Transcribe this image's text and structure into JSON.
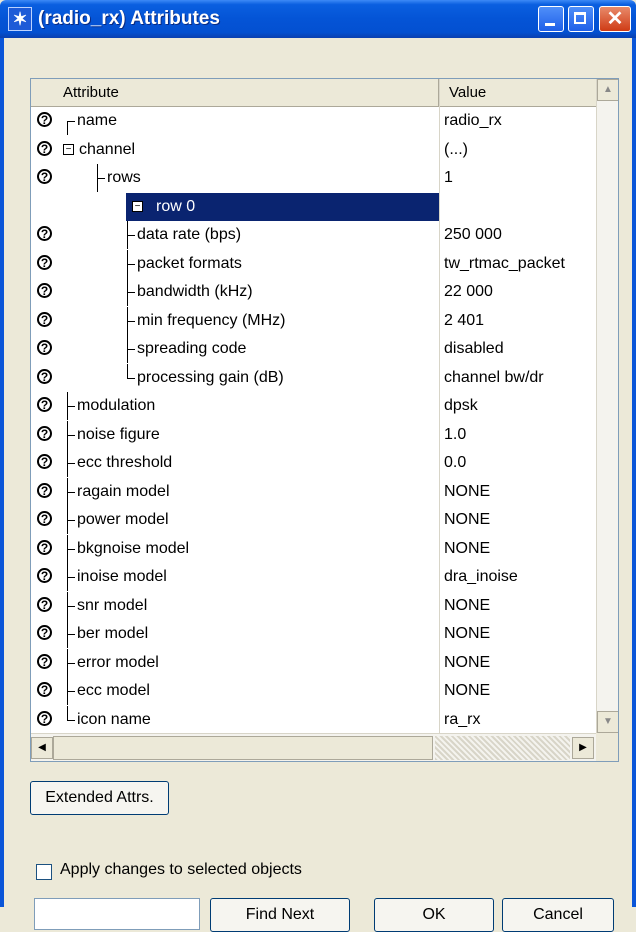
{
  "window": {
    "title": "(radio_rx) Attributes"
  },
  "grid": {
    "header_attribute": "Attribute",
    "header_value": "Value",
    "rows": [
      {
        "label": "name",
        "value": "radio_rx",
        "depth": 0,
        "help": true
      },
      {
        "label": "channel",
        "value": "(...)",
        "depth": 0,
        "help": true,
        "expander": "minus"
      },
      {
        "label": "rows",
        "value": "1",
        "depth": 1,
        "help": true
      },
      {
        "label": "row 0",
        "value": "",
        "depth": 1,
        "help": false,
        "expander": "minus",
        "selected": true
      },
      {
        "label": "data rate (bps)",
        "value": "250 000",
        "depth": 2,
        "help": true
      },
      {
        "label": "packet formats",
        "value": "tw_rtmac_packet",
        "depth": 2,
        "help": true
      },
      {
        "label": "bandwidth (kHz)",
        "value": "22 000",
        "depth": 2,
        "help": true
      },
      {
        "label": "min frequency (MHz)",
        "value": "2 401",
        "depth": 2,
        "help": true
      },
      {
        "label": "spreading code",
        "value": "disabled",
        "depth": 2,
        "help": true
      },
      {
        "label": "processing gain (dB)",
        "value": "channel bw/dr",
        "depth": 2,
        "help": true
      },
      {
        "label": "modulation",
        "value": "dpsk",
        "depth": 0,
        "help": true
      },
      {
        "label": "noise figure",
        "value": "1.0",
        "depth": 0,
        "help": true
      },
      {
        "label": "ecc threshold",
        "value": "0.0",
        "depth": 0,
        "help": true
      },
      {
        "label": "ragain model",
        "value": "NONE",
        "depth": 0,
        "help": true
      },
      {
        "label": "power model",
        "value": "NONE",
        "depth": 0,
        "help": true
      },
      {
        "label": "bkgnoise model",
        "value": "NONE",
        "depth": 0,
        "help": true
      },
      {
        "label": "inoise model",
        "value": "dra_inoise",
        "depth": 0,
        "help": true
      },
      {
        "label": "snr model",
        "value": "NONE",
        "depth": 0,
        "help": true
      },
      {
        "label": "ber model",
        "value": "NONE",
        "depth": 0,
        "help": true
      },
      {
        "label": "error model",
        "value": "NONE",
        "depth": 0,
        "help": true
      },
      {
        "label": "ecc model",
        "value": "NONE",
        "depth": 0,
        "help": true
      },
      {
        "label": "icon name",
        "value": "ra_rx",
        "depth": 0,
        "help": true
      }
    ]
  },
  "buttons": {
    "extended": "Extended Attrs.",
    "find_next": "Find Next",
    "ok": "OK",
    "cancel": "Cancel"
  },
  "options": {
    "apply_label": "Apply changes to selected objects",
    "apply_checked": false
  },
  "search": {
    "value": ""
  },
  "colors": {
    "title_bar": "#0a55d8",
    "selection": "#0a2470",
    "close_button": "#cf3b15"
  }
}
